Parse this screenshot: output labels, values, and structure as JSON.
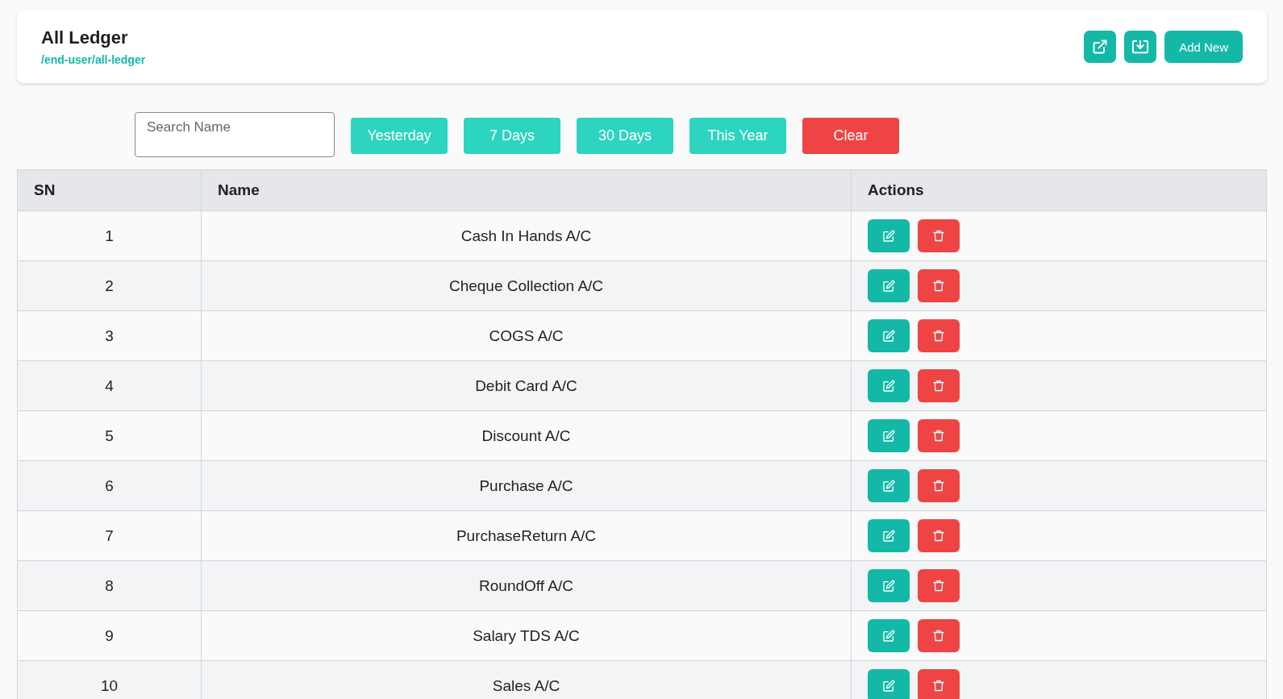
{
  "header": {
    "title": "All Ledger",
    "path": "/end-user/all-ledger",
    "add_button": "Add New"
  },
  "filters": {
    "search": {
      "placeholder": "Search Name"
    },
    "buttons": [
      {
        "label": "Yesterday",
        "kind": "range"
      },
      {
        "label": "7 Days",
        "kind": "range"
      },
      {
        "label": "30 Days",
        "kind": "range"
      },
      {
        "label": "This Year",
        "kind": "range"
      },
      {
        "label": "Clear",
        "kind": "clear"
      }
    ]
  },
  "table": {
    "columns": [
      "SN",
      "Name",
      "Actions"
    ],
    "rows": [
      {
        "sn": "1",
        "name": "Cash In Hands A/C"
      },
      {
        "sn": "2",
        "name": "Cheque Collection A/C"
      },
      {
        "sn": "3",
        "name": "COGS A/C"
      },
      {
        "sn": "4",
        "name": "Debit Card A/C"
      },
      {
        "sn": "5",
        "name": "Discount A/C"
      },
      {
        "sn": "6",
        "name": "Purchase A/C"
      },
      {
        "sn": "7",
        "name": "PurchaseReturn A/C"
      },
      {
        "sn": "8",
        "name": "RoundOff A/C"
      },
      {
        "sn": "9",
        "name": "Salary TDS A/C"
      },
      {
        "sn": "10",
        "name": "Sales A/C"
      }
    ]
  }
}
